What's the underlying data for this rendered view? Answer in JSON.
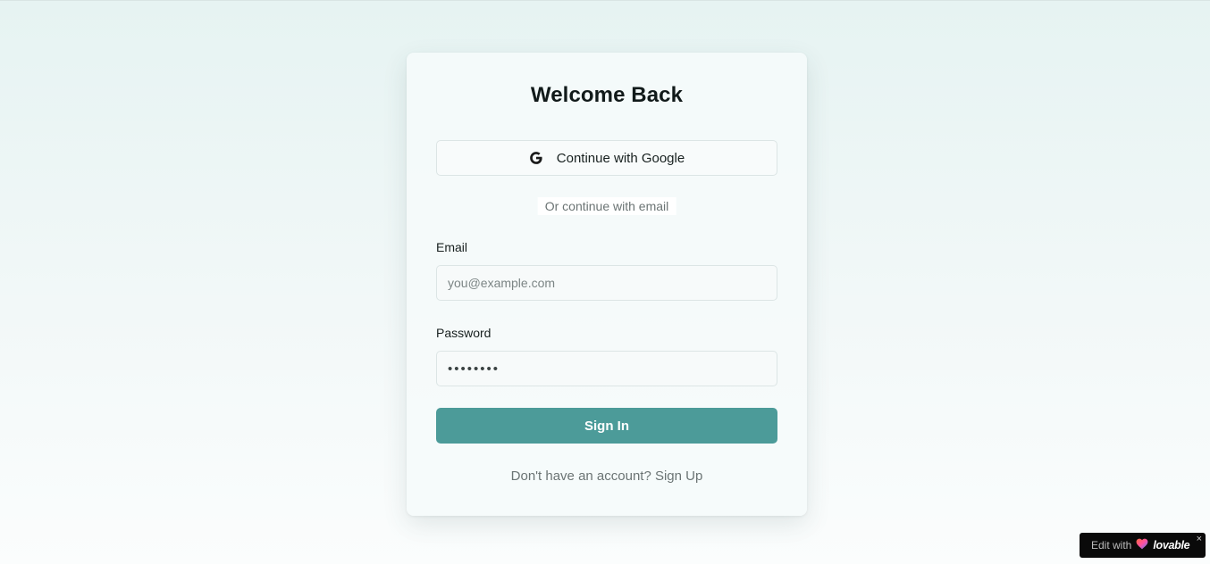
{
  "login": {
    "title": "Welcome Back",
    "google_button": "Continue with Google",
    "divider_text": "Or continue with email",
    "email_label": "Email",
    "email_placeholder": "you@example.com",
    "email_value": "",
    "password_label": "Password",
    "password_value": "••••••••",
    "signin_button": "Sign In",
    "signup_prompt": "Don't have an account? Sign Up"
  },
  "badge": {
    "prefix": "Edit with",
    "brand": "lovable",
    "close": "×"
  },
  "colors": {
    "primary": "#4c9b99",
    "title_text": "#111a1a",
    "muted_text": "#6b7474"
  },
  "icons": {
    "google": "google-icon",
    "heart": "heart-icon",
    "close": "close-icon"
  }
}
